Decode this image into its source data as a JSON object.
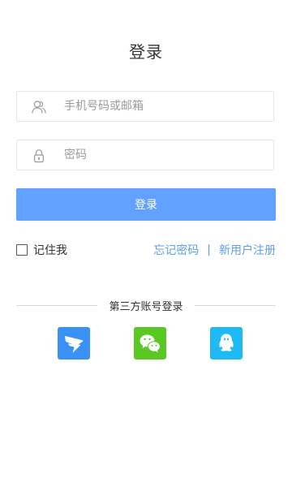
{
  "page": {
    "title": "登录"
  },
  "form": {
    "account_placeholder": "手机号码或邮箱",
    "password_placeholder": "密码",
    "login_button": "登录",
    "remember_label": "记住我",
    "forgot_link": "忘记密码",
    "separator": "|",
    "register_link": "新用户注册"
  },
  "third_party": {
    "heading": "第三方账号登录",
    "providers": [
      {
        "icon": "dingtalk-icon",
        "color": "#3a91f5"
      },
      {
        "icon": "wechat-icon",
        "color": "#5ac823"
      },
      {
        "icon": "qq-icon",
        "color": "#1ebaf3"
      }
    ]
  },
  "colors": {
    "primary_button": "#62a1ff",
    "link": "#5e9eea"
  }
}
